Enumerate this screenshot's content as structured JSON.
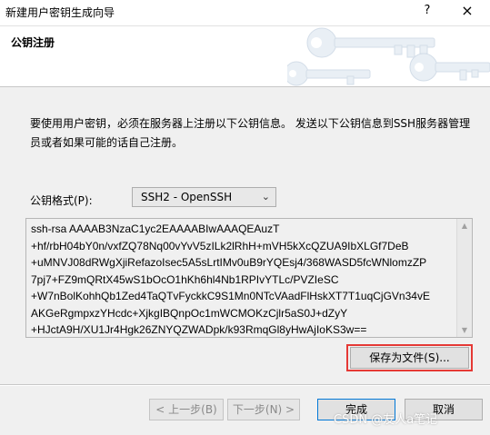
{
  "window": {
    "title": "新建用户密钥生成向导",
    "help_glyph": "?",
    "close_glyph": "×"
  },
  "header": {
    "heading": "公钥注册"
  },
  "description": "要使用用户密钥，必须在服务器上注册以下公钥信息。 发送以下公钥信息到SSH服务器管理员或者如果可能的话自己注册。",
  "format": {
    "label": "公钥格式(P):",
    "selected": "SSH2 - OpenSSH"
  },
  "public_key_lines": [
    "ssh-rsa AAAAB3NzaC1yc2EAAAABIwAAAQEAuzT",
    "+hf/rbH04bY0n/vxfZQ78Nq00vYvV5zILk2lRhH+mVH5kXcQZUA9IbXLGf7DeB",
    "+uMNVJ08dRWgXjiRefazoIsec5A5sLrtIMv0uB9rYQEsj4/368WASD5fcWNlomzZP",
    "7pj7+FZ9mQRtX45wS1bOcO1hKh6hl4Nb1RPIvYTLc/PVZIeSC",
    "+W7nBolKohhQb1Zed4TaQTvFyckkC9S1Mn0NTcVAadFlHskXT7T1uqCjGVn34vE",
    "AKGeRgmpxzYHcdc+XjkgIBQnpOc1mWCMOKzCjlr5aS0J+dZyY",
    "+HJctA9H/XU1Jr4Hgk26ZNYQZWADpk/k93RmqGl8yHwAjIoKS3w=="
  ],
  "buttons": {
    "save_to_file": "保存为文件(S)...",
    "back": "< 上一步(B)",
    "next": "下一步(N) >",
    "finish": "完成",
    "cancel": "取消"
  },
  "watermark": "CSDN @友人a笔记",
  "colors": {
    "highlight_border": "#e53935",
    "default_button_border": "#0078d7"
  }
}
